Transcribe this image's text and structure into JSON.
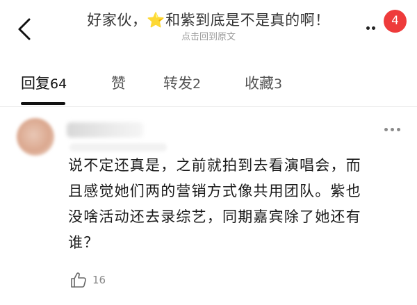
{
  "header": {
    "title_before_star": "好家伙，",
    "star_glyph": "⭐",
    "title_after_star": "和紫到底是不是真的啊！",
    "subtitle": "点击回到原文",
    "notification_count": "4"
  },
  "tabs": [
    {
      "label": "回复",
      "count": "64",
      "active": true
    },
    {
      "label": "赞",
      "count": "",
      "active": false
    },
    {
      "label": "转发",
      "count": "2",
      "active": false
    },
    {
      "label": "收藏",
      "count": "3",
      "active": false
    }
  ],
  "comment": {
    "lines": [
      "说不定还真是，之前就拍到去看演唱会，而",
      "且感觉她们两的营销方式像共用团队。紫也",
      "没啥活动还去录综艺，同期嘉宾除了她还有",
      "谁？"
    ],
    "like_count": "16"
  },
  "colors": {
    "badge": "#ee3b3b",
    "star": "#f5b400",
    "active_tab_underline": "#111111",
    "muted_text": "#9a9a9a"
  }
}
